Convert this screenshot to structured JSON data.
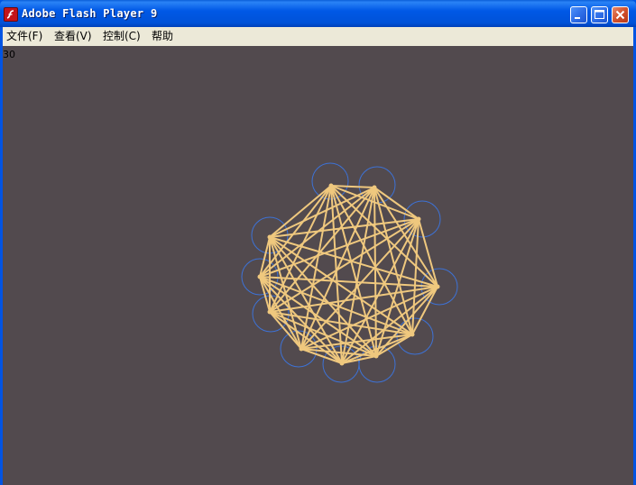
{
  "window": {
    "title": "Adobe Flash Player 9",
    "icon": "flash-player-icon"
  },
  "titlebar_buttons": {
    "minimize": "minimize-icon",
    "maximize": "maximize-icon",
    "close": "close-icon"
  },
  "menu": {
    "items": [
      {
        "label": "文件(F)"
      },
      {
        "label": "查看(V)"
      },
      {
        "label": "控制(C)"
      },
      {
        "label": "帮助"
      }
    ]
  },
  "stage": {
    "background_color": "#524a4e",
    "counter_text": "30",
    "graph": {
      "node_count": 11,
      "edge_color": "#efc87e",
      "circle_color": "#3d72d6",
      "connectivity": "complete"
    }
  }
}
